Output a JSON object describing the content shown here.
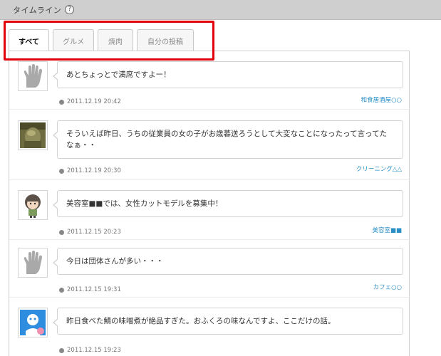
{
  "header": {
    "title": "タイムライン",
    "help_glyph": "?"
  },
  "tabs": [
    {
      "label": "すべて",
      "active": true
    },
    {
      "label": "グルメ",
      "active": false
    },
    {
      "label": "焼肉",
      "active": false
    },
    {
      "label": "自分の投稿",
      "active": false
    }
  ],
  "posts": [
    {
      "avatar": "hand-icon",
      "text": "あとちょっとで満席ですよー！",
      "time": "2011.12.19 20:42",
      "shop": "和食居酒屋○○"
    },
    {
      "avatar": "photo-avatar",
      "text": "そういえば昨日、うちの従業員の女の子がお歳暮送ろうとして大変なことになったって言ってたなぁ・・",
      "time": "2011.12.19 20:30",
      "shop": "クリーニング△△"
    },
    {
      "avatar": "girl-avatar",
      "text": "美容室■■では、女性カットモデルを募集中！",
      "time": "2011.12.15 20:23",
      "shop": "美容室■■"
    },
    {
      "avatar": "hand-icon",
      "text": "今日は団体さんが多い・・・",
      "time": "2011.12.15 19:31",
      "shop": "カフェ○○"
    },
    {
      "avatar": "cartoon-avatar",
      "text": "昨日食べた鯖の味噌煮が絶品すぎた。おふくろの味なんですよ、ここだけの話。",
      "time": "2011.12.15 19:23",
      "shop": ""
    }
  ],
  "colors": {
    "highlight": "#e0000b",
    "link": "#2a8fc7",
    "header_bg": "#cfcfcf"
  }
}
